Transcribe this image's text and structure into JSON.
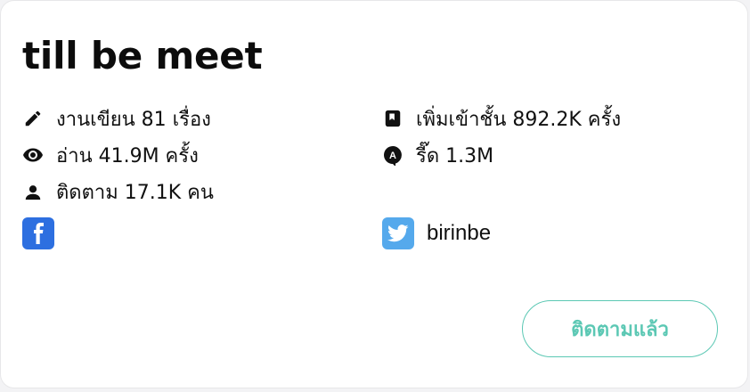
{
  "profile": {
    "name": "till be meet"
  },
  "stats": {
    "works": "งานเขียน 81 เรื่อง",
    "reads": "อ่าน 41.9M ครั้ง",
    "followers": "ติดตาม 17.1K คน",
    "library_adds": "เพิ่มเข้าชั้น 892.2K ครั้ง",
    "comments": "รี๊ด 1.3M"
  },
  "social": {
    "facebook_icon": "facebook-icon",
    "twitter_icon": "twitter-icon",
    "twitter_handle": "birinbe"
  },
  "follow_button": {
    "label": "ติดตามแล้ว"
  },
  "colors": {
    "accent": "#5cc8b4",
    "facebook": "#2d6fe0",
    "twitter": "#55a9ec",
    "text": "#111111"
  }
}
